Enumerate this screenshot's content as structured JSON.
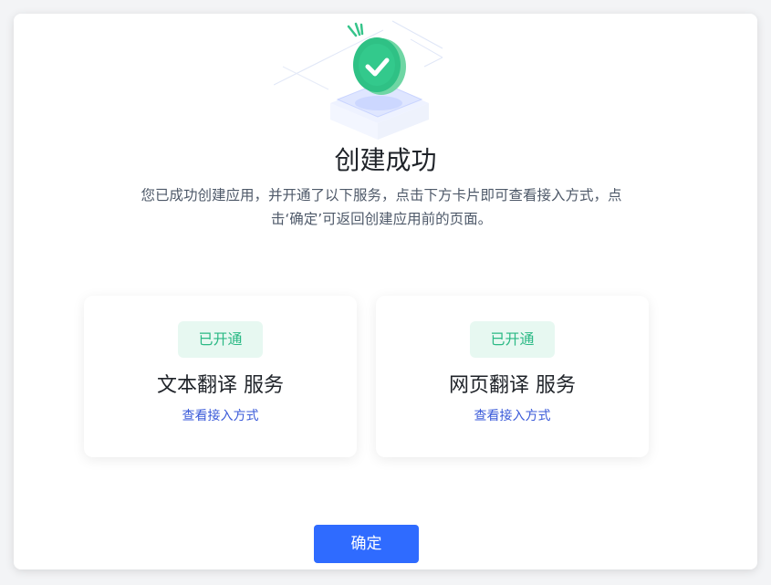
{
  "dialog": {
    "title": "创建成功",
    "description_line1": "您已成功创建应用，并开通了以下服务，点击下方卡片即可查看接入方式，点",
    "description_line2": "击‘确定’可返回创建应用前的页面。",
    "illustration_icon": "success-check-icon"
  },
  "cards": [
    {
      "badge": "已开通",
      "title": "文本翻译 服务",
      "link": "查看接入方式"
    },
    {
      "badge": "已开通",
      "title": "网页翻译 服务",
      "link": "查看接入方式"
    }
  ],
  "footer": {
    "confirm_label": "确定"
  },
  "colors": {
    "primary": "#2f6bff",
    "success": "#2bb985",
    "badge_bg": "#e7f8f1",
    "link": "#3a5ad9"
  }
}
